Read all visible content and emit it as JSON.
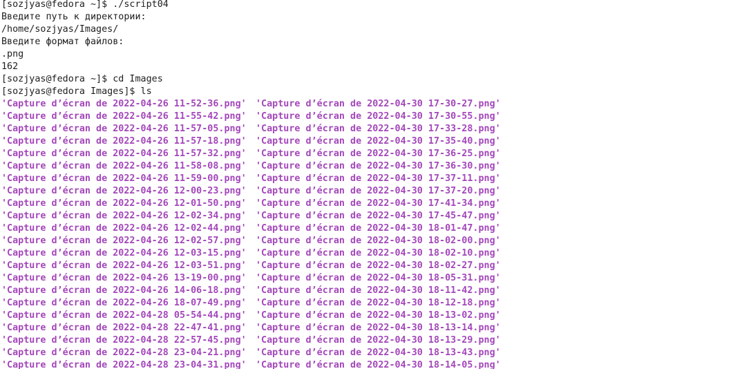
{
  "terminal": {
    "lines": [
      "[sozjyas@fedora ~]$ ./script04",
      "Введите путь к директории:",
      "/home/sozjyas/Images/",
      "Введите формат файлов:",
      ".png",
      "162",
      "[sozjyas@fedora ~]$ cd Images",
      "[sozjyas@fedora Images]$ ls"
    ],
    "ls_rows": [
      [
        "'Capture d’écran de 2022-04-26 11-52-36.png'",
        "'Capture d’écran de 2022-04-30 17-30-27.png'"
      ],
      [
        "'Capture d’écran de 2022-04-26 11-55-42.png'",
        "'Capture d’écran de 2022-04-30 17-30-55.png'"
      ],
      [
        "'Capture d’écran de 2022-04-26 11-57-05.png'",
        "'Capture d’écran de 2022-04-30 17-33-28.png'"
      ],
      [
        "'Capture d’écran de 2022-04-26 11-57-18.png'",
        "'Capture d’écran de 2022-04-30 17-35-40.png'"
      ],
      [
        "'Capture d’écran de 2022-04-26 11-57-32.png'",
        "'Capture d’écran de 2022-04-30 17-36-25.png'"
      ],
      [
        "'Capture d’écran de 2022-04-26 11-58-08.png'",
        "'Capture d’écran de 2022-04-30 17-36-30.png'"
      ],
      [
        "'Capture d’écran de 2022-04-26 11-59-00.png'",
        "'Capture d’écran de 2022-04-30 17-37-11.png'"
      ],
      [
        "'Capture d’écran de 2022-04-26 12-00-23.png'",
        "'Capture d’écran de 2022-04-30 17-37-20.png'"
      ],
      [
        "'Capture d’écran de 2022-04-26 12-01-50.png'",
        "'Capture d’écran de 2022-04-30 17-41-34.png'"
      ],
      [
        "'Capture d’écran de 2022-04-26 12-02-34.png'",
        "'Capture d’écran de 2022-04-30 17-45-47.png'"
      ],
      [
        "'Capture d’écran de 2022-04-26 12-02-44.png'",
        "'Capture d’écran de 2022-04-30 18-01-47.png'"
      ],
      [
        "'Capture d’écran de 2022-04-26 12-02-57.png'",
        "'Capture d’écran de 2022-04-30 18-02-00.png'"
      ],
      [
        "'Capture d’écran de 2022-04-26 12-03-15.png'",
        "'Capture d’écran de 2022-04-30 18-02-10.png'"
      ],
      [
        "'Capture d’écran de 2022-04-26 12-03-51.png'",
        "'Capture d’écran de 2022-04-30 18-02-27.png'"
      ],
      [
        "'Capture d’écran de 2022-04-26 13-19-00.png'",
        "'Capture d’écran de 2022-04-30 18-05-31.png'"
      ],
      [
        "'Capture d’écran de 2022-04-26 14-06-18.png'",
        "'Capture d’écran de 2022-04-30 18-11-42.png'"
      ],
      [
        "'Capture d’écran de 2022-04-26 18-07-49.png'",
        "'Capture d’écran de 2022-04-30 18-12-18.png'"
      ],
      [
        "'Capture d’écran de 2022-04-28 05-54-44.png'",
        "'Capture d’écran de 2022-04-30 18-13-02.png'"
      ],
      [
        "'Capture d’écran de 2022-04-28 22-47-41.png'",
        "'Capture d’écran de 2022-04-30 18-13-14.png'"
      ],
      [
        "'Capture d’écran de 2022-04-28 22-57-45.png'",
        "'Capture d’écran de 2022-04-30 18-13-29.png'"
      ],
      [
        "'Capture d’écran de 2022-04-28 23-04-21.png'",
        "'Capture d’écran de 2022-04-30 18-13-43.png'"
      ],
      [
        "'Capture d’écran de 2022-04-28 23-04-31.png'",
        "'Capture d’écran de 2022-04-30 18-14-05.png'"
      ]
    ],
    "colors": {
      "background": "#ffffff",
      "text": "#1e1e1e",
      "filename": "#a347ba"
    }
  }
}
